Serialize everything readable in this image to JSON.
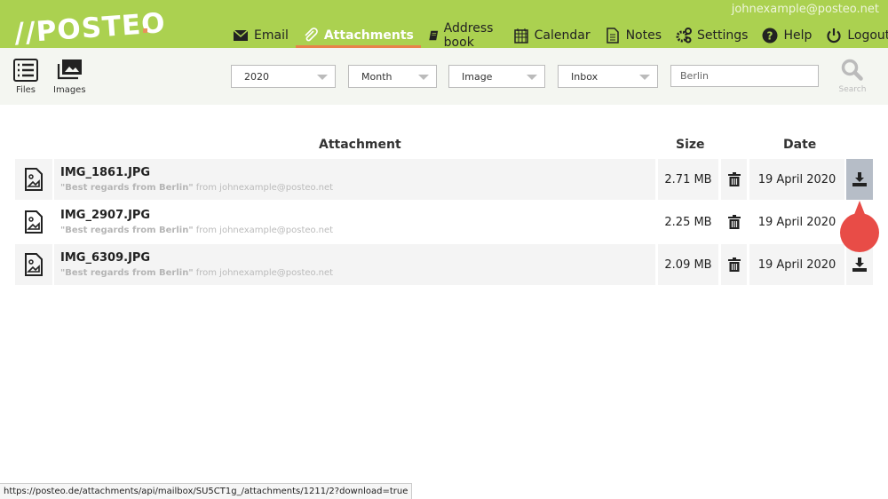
{
  "header": {
    "logo": "//POSTEO",
    "user": "johnexample@posteo.net",
    "nav": [
      {
        "label": "Email",
        "icon": "envelope-icon"
      },
      {
        "label": "Attachments",
        "icon": "paperclip-icon",
        "active": true
      },
      {
        "label": "Address book",
        "icon": "book-icon"
      },
      {
        "label": "Calendar",
        "icon": "calendar-icon"
      },
      {
        "label": "Notes",
        "icon": "notes-icon"
      },
      {
        "label": "Settings",
        "icon": "gears-icon"
      },
      {
        "label": "Help",
        "icon": "question-icon"
      },
      {
        "label": "Logout",
        "icon": "power-icon"
      }
    ]
  },
  "toolbar": {
    "files": "Files",
    "images": "Images",
    "year": "2020",
    "period": "Month",
    "type": "Image",
    "folder": "Inbox",
    "search_value": "Berlin",
    "search_label": "Search"
  },
  "table": {
    "headers": {
      "attachment": "Attachment",
      "size": "Size",
      "date": "Date"
    },
    "rows": [
      {
        "name": "IMG_1861.JPG",
        "subject": "\"Best regards from Berlin\"",
        "from": " from johnexample@posteo.net",
        "size": "2.71 MB",
        "date": "19 April 2020"
      },
      {
        "name": "IMG_2907.JPG",
        "subject": "\"Best regards from Berlin\"",
        "from": " from johnexample@posteo.net",
        "size": "2.25 MB",
        "date": "19 April 2020"
      },
      {
        "name": "IMG_6309.JPG",
        "subject": "\"Best regards from Berlin\"",
        "from": " from johnexample@posteo.net",
        "size": "2.09 MB",
        "date": "19 April 2020"
      }
    ]
  },
  "status_url": "https://posteo.de/attachments/api/mailbox/SU5CT1g_/attachments/1211/2?download=true",
  "colors": {
    "header": "#abd150",
    "active_underline": "#e8824a",
    "marker": "#e84c47"
  }
}
